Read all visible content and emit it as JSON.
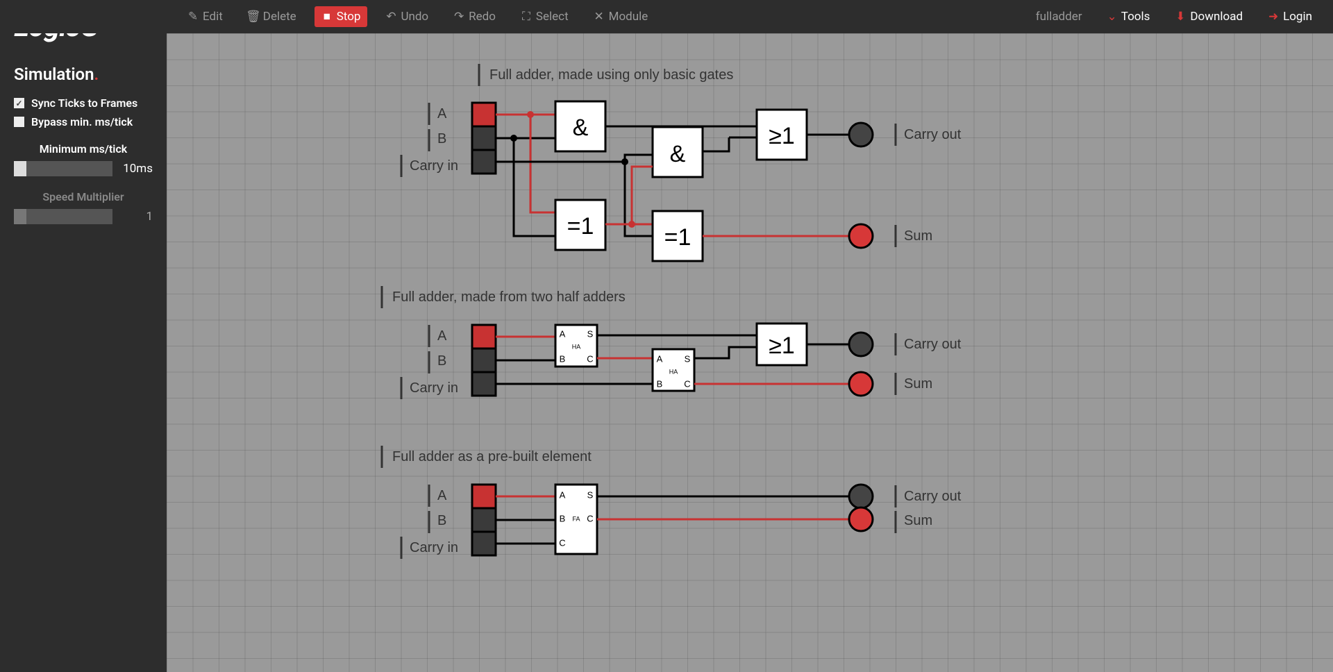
{
  "app": {
    "name": "LogiJS"
  },
  "toolbar": {
    "edit": "Edit",
    "delete": "Delete",
    "stop": "Stop",
    "undo": "Undo",
    "redo": "Redo",
    "select": "Select",
    "module": "Module",
    "sketch": "fulladder",
    "tools": "Tools",
    "download": "Download",
    "login": "Login"
  },
  "sidebar": {
    "title": "Simulation",
    "sync": "Sync Ticks to Frames",
    "bypass": "Bypass min. ms/tick",
    "min_label": "Minimum ms/tick",
    "min_value": "10ms",
    "speed_label": "Speed Multiplier",
    "speed_value": "1"
  },
  "circuits": {
    "c1": {
      "caption": "Full adder, made using only basic gates",
      "inputs": [
        "A",
        "B",
        "Carry in"
      ],
      "gates": {
        "and": "&",
        "xor": "=1",
        "or": "≥1"
      },
      "outputs": [
        "Carry out",
        "Sum"
      ]
    },
    "c2": {
      "caption": "Full adder, made from two half adders",
      "inputs": [
        "A",
        "B",
        "Carry in"
      ],
      "ha": {
        "name": "HA",
        "a": "A",
        "b": "B",
        "s": "S",
        "c": "C"
      },
      "or": "≥1",
      "outputs": [
        "Carry out",
        "Sum"
      ]
    },
    "c3": {
      "caption": "Full adder as a pre-built element",
      "inputs": [
        "A",
        "B",
        "Carry in"
      ],
      "fa": {
        "name": "FA",
        "a": "A",
        "b": "B",
        "c": "C",
        "s": "S",
        "co": "C"
      },
      "outputs": [
        "Carry out",
        "Sum"
      ]
    }
  }
}
